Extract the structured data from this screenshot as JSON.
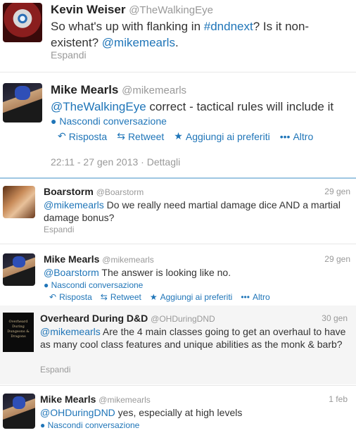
{
  "tweets": [
    {
      "author": "Kevin Weiser",
      "handle": "@TheWalkingEye",
      "text_pre": "So what's up with flanking in ",
      "hashtag": "#dndnext",
      "text_mid": "? Is it non-existent?",
      "mention": "@mikemearls",
      "text_post": ".",
      "expand": "Espandi"
    },
    {
      "author": "Mike Mearls",
      "handle": "@mikemearls",
      "mention": "@TheWalkingEye",
      "text": " correct - tactical rules will include it",
      "hide_convo": "Nascondi conversazione",
      "actions": {
        "reply": "Risposta",
        "retweet": "Retweet",
        "favorite": "Aggiungi ai preferiti",
        "more": "Altro"
      },
      "timestamp": "22:11 - 27 gen 2013",
      "details": "Dettagli"
    },
    {
      "author": "Boarstorm",
      "handle": "@Boarstorm",
      "time": "29 gen",
      "mention": "@mikemearls",
      "text": " Do we really need martial damage dice AND a martial damage bonus?",
      "expand": "Espandi"
    },
    {
      "author": "Mike Mearls",
      "handle": "@mikemearls",
      "time": "29 gen",
      "mention": "@Boarstorm",
      "text": " The answer is looking like no.",
      "hide_convo": "Nascondi conversazione",
      "actions": {
        "reply": "Risposta",
        "retweet": "Retweet",
        "favorite": "Aggiungi ai preferiti",
        "more": "Altro"
      }
    },
    {
      "author": "Overheard During D&D",
      "handle": "@OHDuringDND",
      "time": "30 gen",
      "mention": "@mikemearls",
      "text": " Are the 4 main classes going to get an overhaul to have as many cool class features and unique abilities as the monk & barb?",
      "expand": "Espandi",
      "avatar_text": "Overheard During Dungeons & Dragons"
    },
    {
      "author": "Mike Mearls",
      "handle": "@mikemearls",
      "time": "1 feb",
      "mention": "@OHDuringDND",
      "text": " yes, especially at high levels",
      "hide_convo": "Nascondi conversazione"
    }
  ],
  "icons": {
    "reply": "reply-arrow-icon",
    "retweet": "retweet-icon",
    "favorite": "star-icon",
    "more": "more-dots-icon",
    "convo": "speech-bubble-icon"
  },
  "colors": {
    "link": "#1f75b8",
    "muted": "#999999",
    "separator": "#9ec6e2"
  }
}
